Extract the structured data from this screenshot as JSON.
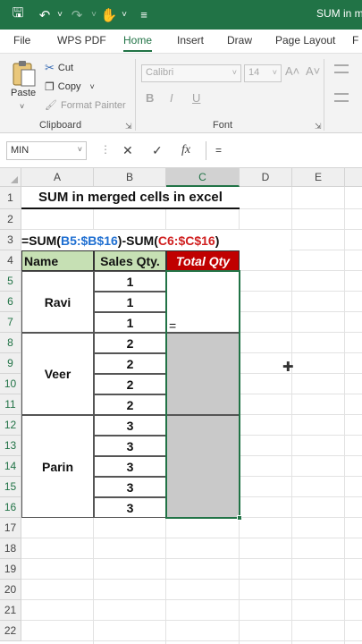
{
  "titlebar": {
    "title": "SUM in me",
    "save_icon": "🖫",
    "undo_icon": "↶",
    "undo_menu": "˅",
    "redo_icon": "↷",
    "redo_menu": "˅",
    "touch_icon": "✋",
    "touch_menu": "˅",
    "customize_icon": "≡"
  },
  "tabs": [
    "File",
    "WPS PDF",
    "Home",
    "Insert",
    "Draw",
    "Page Layout",
    "F"
  ],
  "ribbon": {
    "paste_label": "Paste",
    "paste_arrow": "˅",
    "cut": "Cut",
    "cut_icon": "✂",
    "copy": "Copy",
    "copy_icon": "❐",
    "copy_arrow": "˅",
    "format_painter": "Format Painter",
    "format_painter_icon": "🖌",
    "clipboard_label": "Clipboard",
    "font_name": "Calibri",
    "font_size": "14",
    "combo_arrow": "˅",
    "font_label": "Font",
    "grow_font": "A˄",
    "shrink_font": "A˅",
    "bold": "B",
    "italic": "I",
    "underline": "U",
    "launcher": "⇲"
  },
  "formula_bar": {
    "name_box": "MIN",
    "name_box_arrow": "˅",
    "more": "⋮",
    "cancel": "✕",
    "enter": "✓",
    "fx": "fx",
    "content": "="
  },
  "columns": [
    "A",
    "B",
    "C",
    "D",
    "E"
  ],
  "rows": [
    "1",
    "2",
    "3",
    "4",
    "5",
    "6",
    "7",
    "8",
    "9",
    "10",
    "11",
    "12",
    "13",
    "14",
    "15",
    "16",
    "17",
    "18",
    "19",
    "20",
    "21",
    "22"
  ],
  "sheet": {
    "title": "SUM in merged cells in excel",
    "formula_parts": [
      "=SUM(",
      "B5:$B$16",
      ")-SUM(",
      "C6:$C$16",
      ")"
    ],
    "header_name": "Name",
    "header_sales": "Sales Qty.",
    "header_total": "Total Qty",
    "names": [
      "Ravi",
      "Veer",
      "Parin"
    ],
    "sales": [
      "1",
      "1",
      "1",
      "2",
      "2",
      "2",
      "2",
      "3",
      "3",
      "3",
      "3",
      "3"
    ],
    "editing_value": "=",
    "cursor_icon": "✚"
  },
  "colors": {
    "accent": "#217346",
    "header_green": "#c6e0b4",
    "header_red": "#c00000"
  }
}
